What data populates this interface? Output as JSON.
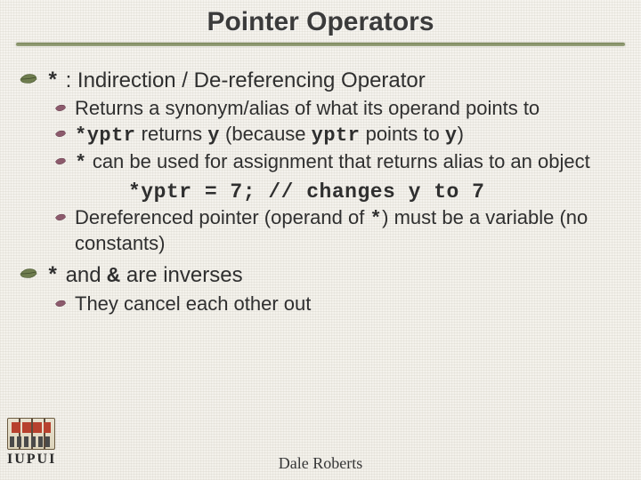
{
  "title": "Pointer Operators",
  "sections": [
    {
      "head_code": "*",
      "head_text": " : Indirection / De-referencing Operator",
      "items": [
        {
          "segments": [
            {
              "t": "Returns a synonym/alias of what its operand points to"
            }
          ]
        },
        {
          "segments": [
            {
              "t": " "
            },
            {
              "t": "*yptr",
              "code": true
            },
            {
              "t": " returns "
            },
            {
              "t": "y",
              "code": true
            },
            {
              "t": " (because "
            },
            {
              "t": "yptr",
              "code": true
            },
            {
              "t": " points to "
            },
            {
              "t": "y",
              "code": true
            },
            {
              "t": ")"
            }
          ]
        },
        {
          "segments": [
            {
              "t": " "
            },
            {
              "t": "*",
              "code": true
            },
            {
              "t": " can be used for assignment that returns alias to an object"
            }
          ],
          "code_line_segments": [
            {
              "t": "*yptr = 7;   // changes y to 7",
              "code": true
            }
          ]
        },
        {
          "segments": [
            {
              "t": "Dereferenced pointer (operand of "
            },
            {
              "t": "*",
              "code": true
            },
            {
              "t": ") must be a variable (no constants)"
            }
          ]
        }
      ]
    },
    {
      "head_code": "*",
      "head_text_segments": [
        {
          "t": " and "
        },
        {
          "t": "&",
          "code": true
        },
        {
          "t": " are inverses"
        }
      ],
      "items": [
        {
          "segments": [
            {
              "t": "They cancel each other out"
            }
          ]
        }
      ]
    }
  ],
  "footer": {
    "author": "Dale Roberts",
    "logo_text": "IUPUI"
  }
}
